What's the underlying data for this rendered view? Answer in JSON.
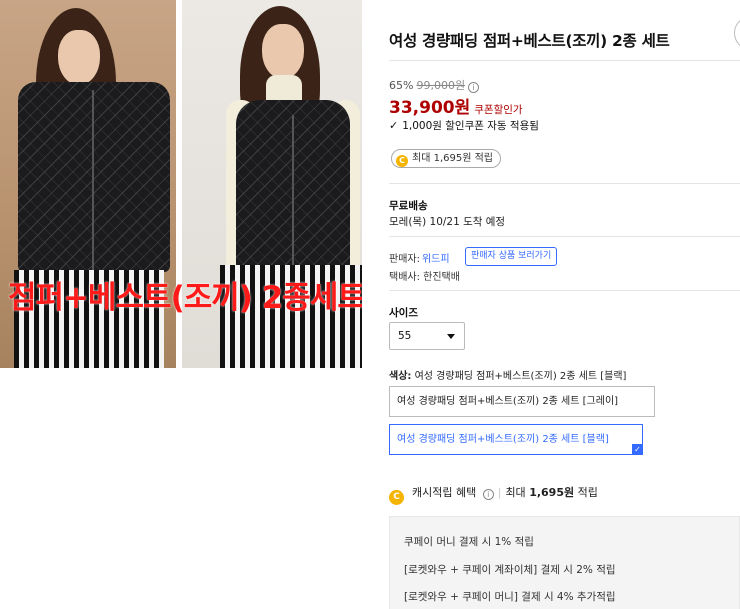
{
  "product": {
    "title": "여성 경량패딩 점퍼+베스트(조끼) 2종 세트",
    "image_overlay_text": "점퍼+베스트(조끼) 2종세트"
  },
  "price": {
    "discount_rate": "65%",
    "original": "99,000원",
    "sale": "33,900원",
    "coupon_label": "쿠폰할인가",
    "coupon_auto": "1,000원 할인쿠폰 자동 적용됨",
    "accent_color": "#ae0000"
  },
  "reward": {
    "pill_label": "최대 1,695원 적립",
    "coin_icon": "coin-icon"
  },
  "shipping": {
    "title": "무료배송",
    "arrival": "모레(목) 10/21 도착 예정"
  },
  "seller": {
    "label": "판매자:",
    "name": "위드피",
    "button": "판매자 상품 보러가기",
    "courier": "택배사: 한진택배"
  },
  "options": {
    "size_label": "사이즈",
    "size_value": "55",
    "color_label": "색상:",
    "color_value": "여성 경량패딩 점퍼+베스트(조끼) 2종 세트 [블랙]",
    "choices": [
      "여성 경량패딩 점퍼+베스트(조끼) 2종 세트 [그레이]",
      "여성 경량패딩 점퍼+베스트(조끼) 2종 세트 [블랙]"
    ],
    "selected_color": "#346aff"
  },
  "cash": {
    "label": "캐시적립 혜택",
    "max": "최대 ",
    "amount": "1,695원",
    "suffix": " 적립"
  },
  "benefits": [
    "쿠페이 머니 결제 시 1% 적립",
    "[로켓와우 + 쿠페이 계좌이체] 결제 시 2% 적립",
    "[로켓와우 + 쿠페이 머니] 결제 시 4% 추가적립"
  ]
}
